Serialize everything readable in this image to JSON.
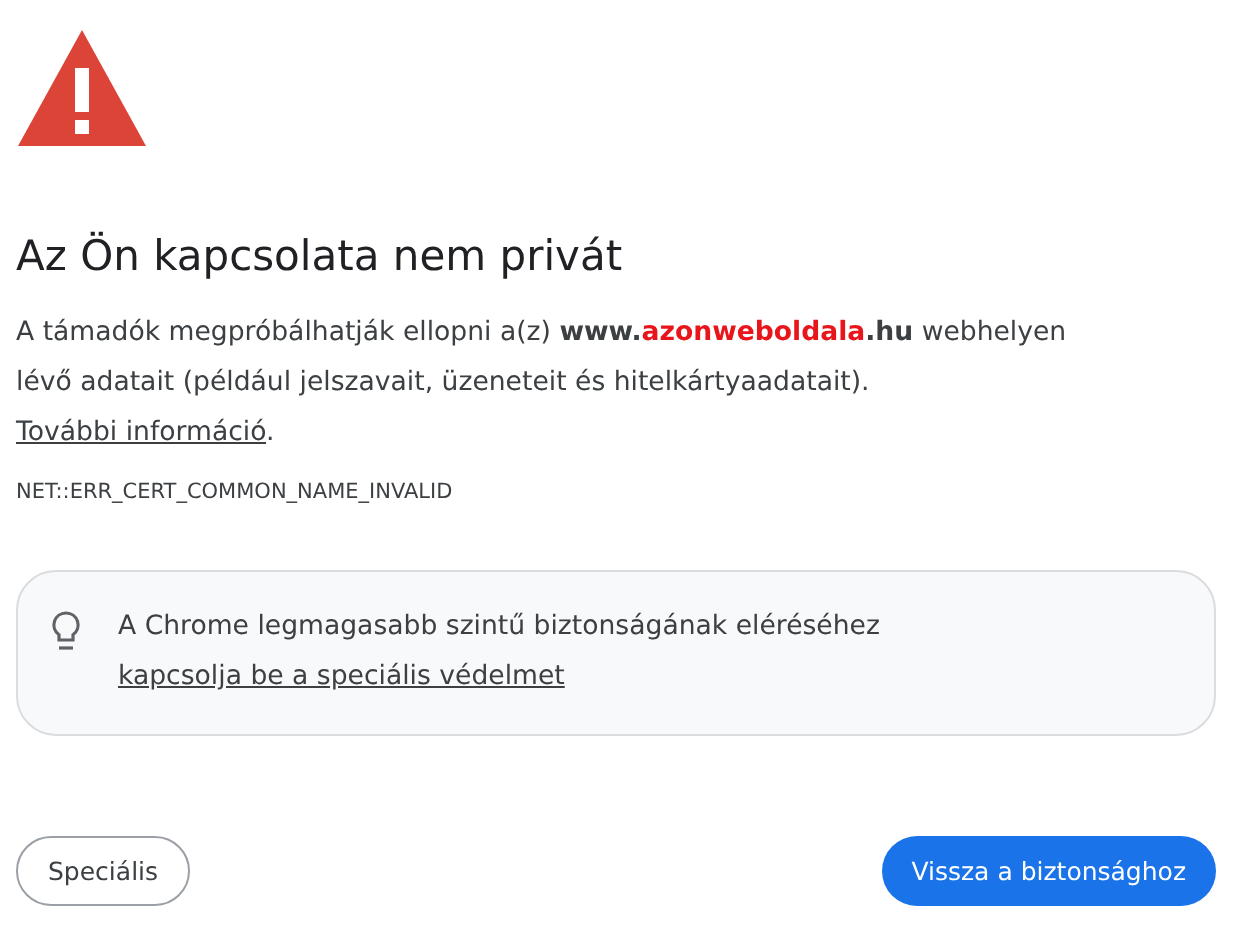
{
  "heading": "Az Ön kapcsolata nem privát",
  "description": {
    "before": "A támadók megpróbálhatják ellopni a(z) ",
    "domain_prefix": "www.",
    "domain_host": "azonweboldala",
    "domain_suffix": ".hu",
    "after": " webhelyen lévő adatait (például jelszavait, üzeneteit és hitelkártyaadatait). ",
    "link": "További információ",
    "end": "."
  },
  "error_code": "NET::ERR_CERT_COMMON_NAME_INVALID",
  "tip": {
    "text": "A Chrome legmagasabb szintű biztonságának eléréséhez ",
    "link": "kapcsolja be a speciális védelmet"
  },
  "buttons": [
    {
      "label": "Speciális",
      "kind": "secondary"
    },
    {
      "label": "Vissza a biztonsághoz",
      "kind": "primary"
    }
  ]
}
